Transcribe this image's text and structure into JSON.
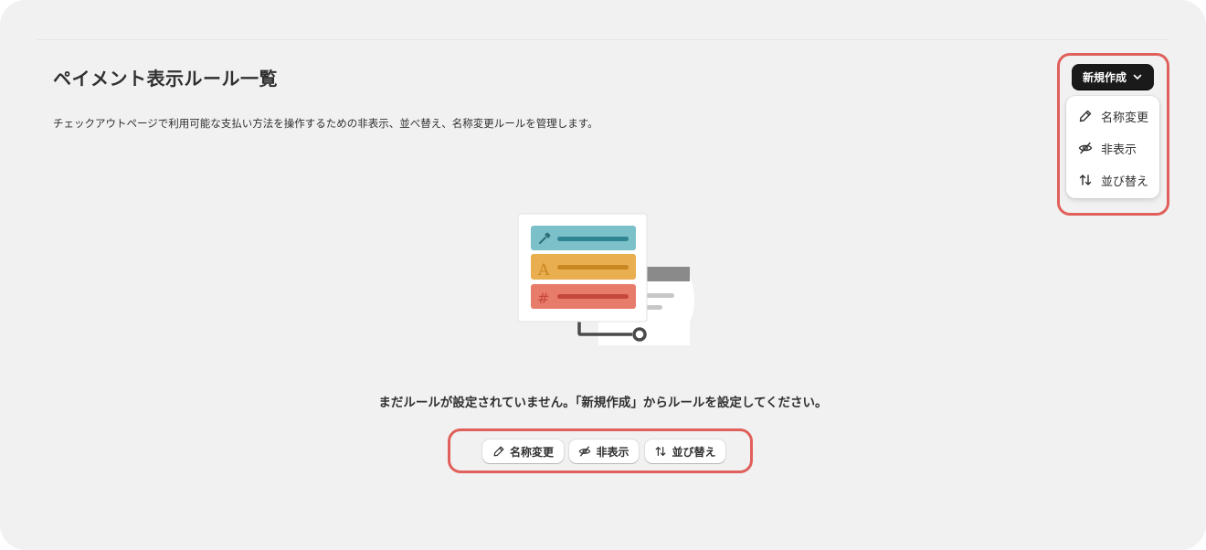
{
  "page": {
    "title": "ペイメント表示ルール一覧",
    "description": "チェックアウトページで利用可能な支払い方法を操作するための非表示、並べ替え、名称変更ルールを管理します。"
  },
  "create_button": {
    "label": "新規作成",
    "icon": "chevron-down-icon"
  },
  "dropdown": {
    "items": [
      {
        "label": "名称変更",
        "icon": "pencil-icon"
      },
      {
        "label": "非表示",
        "icon": "eye-slash-icon"
      },
      {
        "label": "並び替え",
        "icon": "sort-arrows-icon"
      }
    ]
  },
  "empty_state": {
    "message": "まだルールが設定されていません。「新規作成」からルールを設定してください。",
    "buttons": [
      {
        "label": "名称変更",
        "icon": "pencil-icon"
      },
      {
        "label": "非表示",
        "icon": "eye-slash-icon"
      },
      {
        "label": "並び替え",
        "icon": "sort-arrows-icon"
      }
    ]
  },
  "colors": {
    "highlight": "#e0605b",
    "primary": "#1a1a1a",
    "teal": "#7cc0c9",
    "amber": "#e8ae50",
    "coral": "#e87c6a"
  }
}
